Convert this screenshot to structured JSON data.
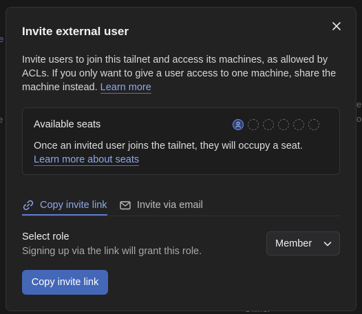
{
  "background": {
    "fragments": [
      "e",
      "e",
      "e",
      "o",
      "Owner"
    ]
  },
  "modal": {
    "title": "Invite external user",
    "close_icon": "close-icon",
    "description": "Invite users to join this tailnet and access its machines, as allowed by ACLs. If you only want to give a user access to one machine, share the machine instead.",
    "learn_more": "Learn more",
    "seats": {
      "title": "Available seats",
      "filled": 1,
      "total": 6,
      "text": "Once an invited user joins the tailnet, they will occupy a seat.",
      "learn_more": "Learn more about seats"
    },
    "tabs": [
      {
        "label": "Copy invite link",
        "icon": "link-icon",
        "active": true
      },
      {
        "label": "Invite via email",
        "icon": "mail-icon",
        "active": false
      }
    ],
    "role": {
      "label": "Select role",
      "sub": "Signing up via the link will grant this role.",
      "selected": "Member"
    },
    "primary_button": "Copy invite link"
  },
  "colors": {
    "accent": "#8ea8e8",
    "primary": "#4467b8",
    "surface": "#222223"
  }
}
